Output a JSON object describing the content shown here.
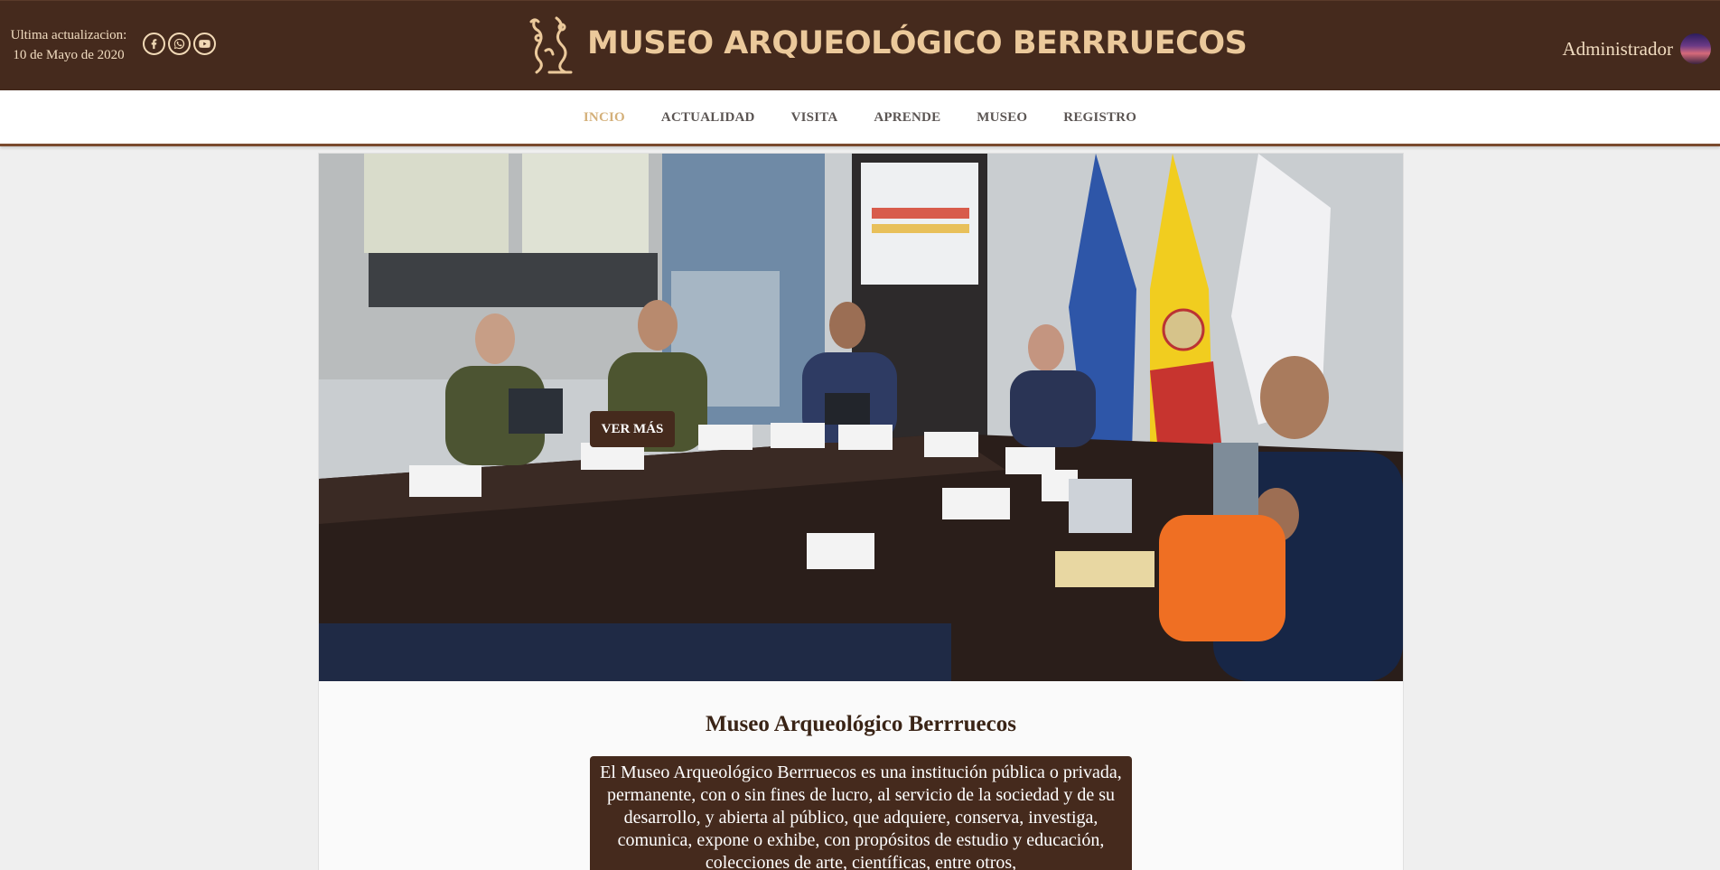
{
  "header": {
    "update_label": "Ultima actualizacion:",
    "update_date": "10 de Mayo de 2020",
    "social": [
      "facebook-icon",
      "whatsapp-icon",
      "youtube-icon"
    ],
    "title": "MUSEO ARQUEOLÓGICO BERRRUECOS",
    "user_name": "Administrador"
  },
  "nav": {
    "items": [
      "INCIO",
      "ACTUALIDAD",
      "VISITA",
      "APRENDE",
      "MUSEO",
      "REGISTRO"
    ],
    "active_index": 0
  },
  "hero": {
    "button_label": "VER MÁS"
  },
  "intro": {
    "title": "Museo Arqueológico Berrruecos",
    "text": "El Museo Arqueológico Berrruecos es una institución pública o privada, permanente, con o sin fines de lucro, al servicio de la sociedad y de su desarrollo, y abierta al público, que adquiere, conserva, investiga, comunica, expone o exhibe, con propósitos de estudio y educación, colecciones de arte, científicas, entre otros,"
  },
  "colors": {
    "header_bg": "#452a1d",
    "brand_text": "#ebc99b",
    "nav_active": "#d4b07a",
    "nav_text": "#5b5553"
  }
}
